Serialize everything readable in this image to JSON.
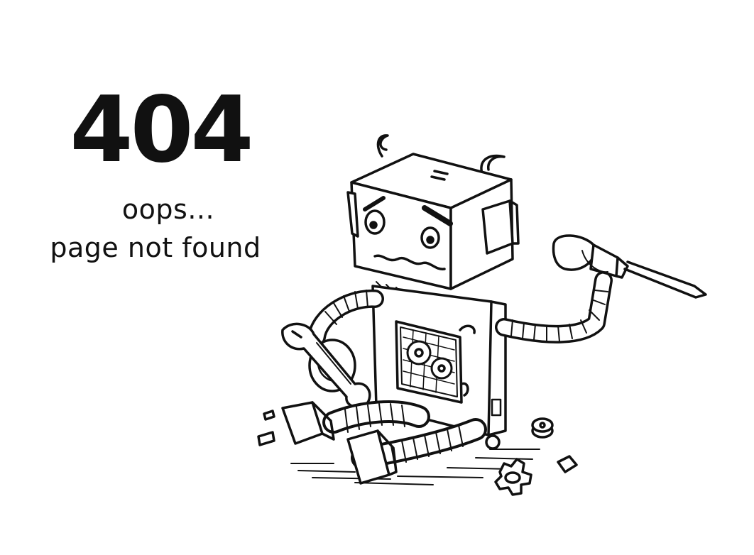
{
  "error": {
    "code": "404",
    "line1": "oops...",
    "line2": "page not found"
  },
  "illustration": {
    "subject": "broken robot sitting with wrench and screwdriver",
    "icons": [
      "robot-icon",
      "wrench-icon",
      "screwdriver-icon",
      "gear-icon",
      "bolt-icon"
    ]
  },
  "colors": {
    "ink": "#111111",
    "background": "#ffffff"
  }
}
